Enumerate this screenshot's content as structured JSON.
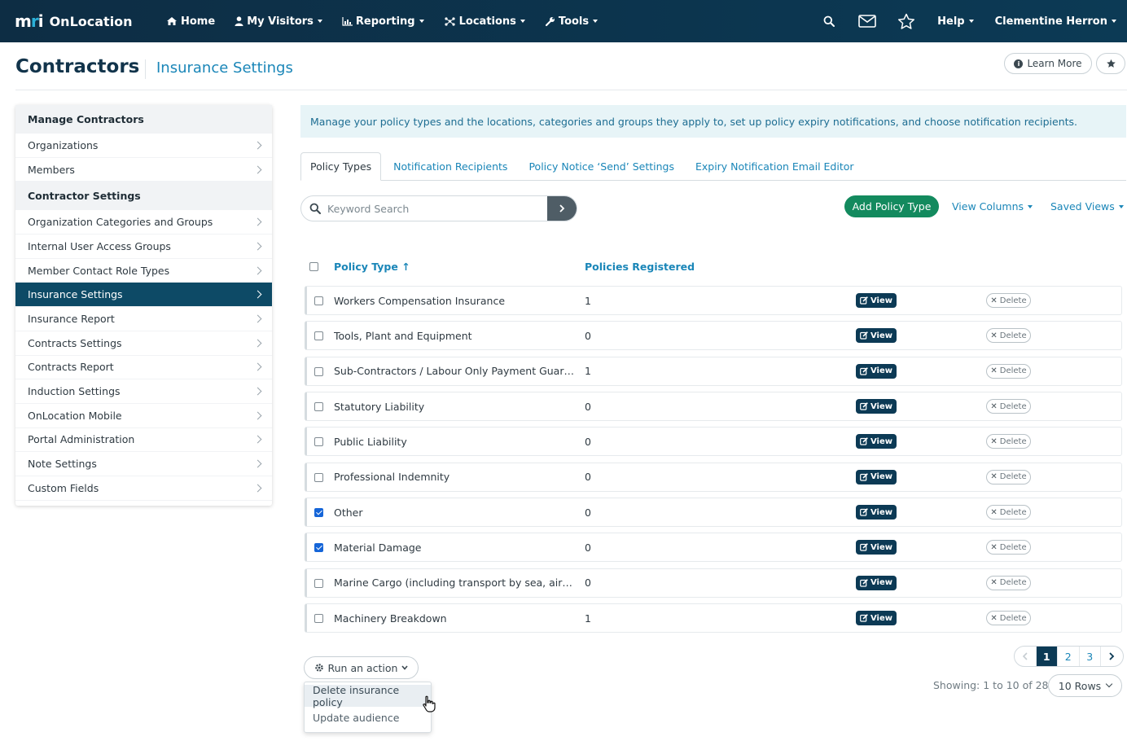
{
  "nav": {
    "brand_mark": "mri",
    "brand_name": "OnLocation",
    "items": [
      {
        "label": "Home",
        "icon": "home-icon",
        "has_caret": false
      },
      {
        "label": "My Visitors",
        "icon": "user-icon",
        "has_caret": true
      },
      {
        "label": "Reporting",
        "icon": "bar-chart-icon",
        "has_caret": true
      },
      {
        "label": "Locations",
        "icon": "network-icon",
        "has_caret": true
      },
      {
        "label": "Tools",
        "icon": "wrench-icon",
        "has_caret": true
      }
    ],
    "help_label": "Help",
    "user_name": "Clementine Herron"
  },
  "header": {
    "title": "Contractors",
    "subtitle": "Insurance Settings",
    "learn_more": "Learn More"
  },
  "sidebar": {
    "sections": [
      {
        "heading": "Manage Contractors",
        "items": [
          {
            "label": "Organizations",
            "active": false
          },
          {
            "label": "Members",
            "active": false
          }
        ]
      },
      {
        "heading": "Contractor Settings",
        "items": [
          {
            "label": "Organization Categories and Groups",
            "active": false
          },
          {
            "label": "Internal User Access Groups",
            "active": false
          },
          {
            "label": "Member Contact Role Types",
            "active": false
          },
          {
            "label": "Insurance Settings",
            "active": true
          },
          {
            "label": "Insurance Report",
            "active": false
          },
          {
            "label": "Contracts Settings",
            "active": false
          },
          {
            "label": "Contracts Report",
            "active": false
          },
          {
            "label": "Induction Settings",
            "active": false
          },
          {
            "label": "OnLocation Mobile",
            "active": false
          },
          {
            "label": "Portal Administration",
            "active": false
          },
          {
            "label": "Note Settings",
            "active": false
          },
          {
            "label": "Custom Fields",
            "active": false
          }
        ]
      }
    ]
  },
  "banner": "Manage your policy types and the locations, categories and groups they apply to, set up policy expiry notifications, and choose notification recipients.",
  "tabs": [
    {
      "label": "Policy Types",
      "active": true
    },
    {
      "label": "Notification Recipients",
      "active": false
    },
    {
      "label": "Policy Notice ‘Send’ Settings",
      "active": false
    },
    {
      "label": "Expiry Notification Email Editor",
      "active": false
    }
  ],
  "search": {
    "placeholder": "Keyword Search",
    "value": ""
  },
  "toolbar": {
    "add_label": "Add Policy Type",
    "view_columns": "View Columns",
    "saved_views": "Saved Views"
  },
  "table": {
    "columns": {
      "policy_type": "Policy Type",
      "sort_indicator": "↑",
      "policies_registered": "Policies Registered"
    },
    "view_label": "View",
    "delete_label": "Delete",
    "rows": [
      {
        "name": "Workers Compensation Insurance",
        "count": "1",
        "checked": false
      },
      {
        "name": "Tools, Plant and Equipment",
        "count": "0",
        "checked": false
      },
      {
        "name": "Sub-Contractors / Labour Only Payment Guaran...",
        "count": "1",
        "checked": false
      },
      {
        "name": "Statutory Liability",
        "count": "0",
        "checked": false
      },
      {
        "name": "Public Liability",
        "count": "0",
        "checked": false
      },
      {
        "name": "Professional Indemnity",
        "count": "0",
        "checked": false
      },
      {
        "name": "Other",
        "count": "0",
        "checked": true
      },
      {
        "name": "Material Damage",
        "count": "0",
        "checked": true
      },
      {
        "name": "Marine Cargo (including transport by sea, air, ro...",
        "count": "0",
        "checked": false
      },
      {
        "name": "Machinery Breakdown",
        "count": "1",
        "checked": false
      }
    ]
  },
  "actions": {
    "run_label": "Run an action",
    "menu": [
      {
        "label": "Delete insurance policy",
        "hover": true
      },
      {
        "label": "Update audience",
        "hover": false
      }
    ]
  },
  "pagination": {
    "pages": [
      "1",
      "2",
      "3"
    ],
    "current": "1",
    "showing": "Showing: 1 to 10 of 28",
    "rows_label": "10 Rows"
  },
  "colors": {
    "nav_bg": "#0c3a55",
    "accent_link": "#1a86b8",
    "primary_green": "#138a5e",
    "active_sidebar": "#0d4a66"
  }
}
